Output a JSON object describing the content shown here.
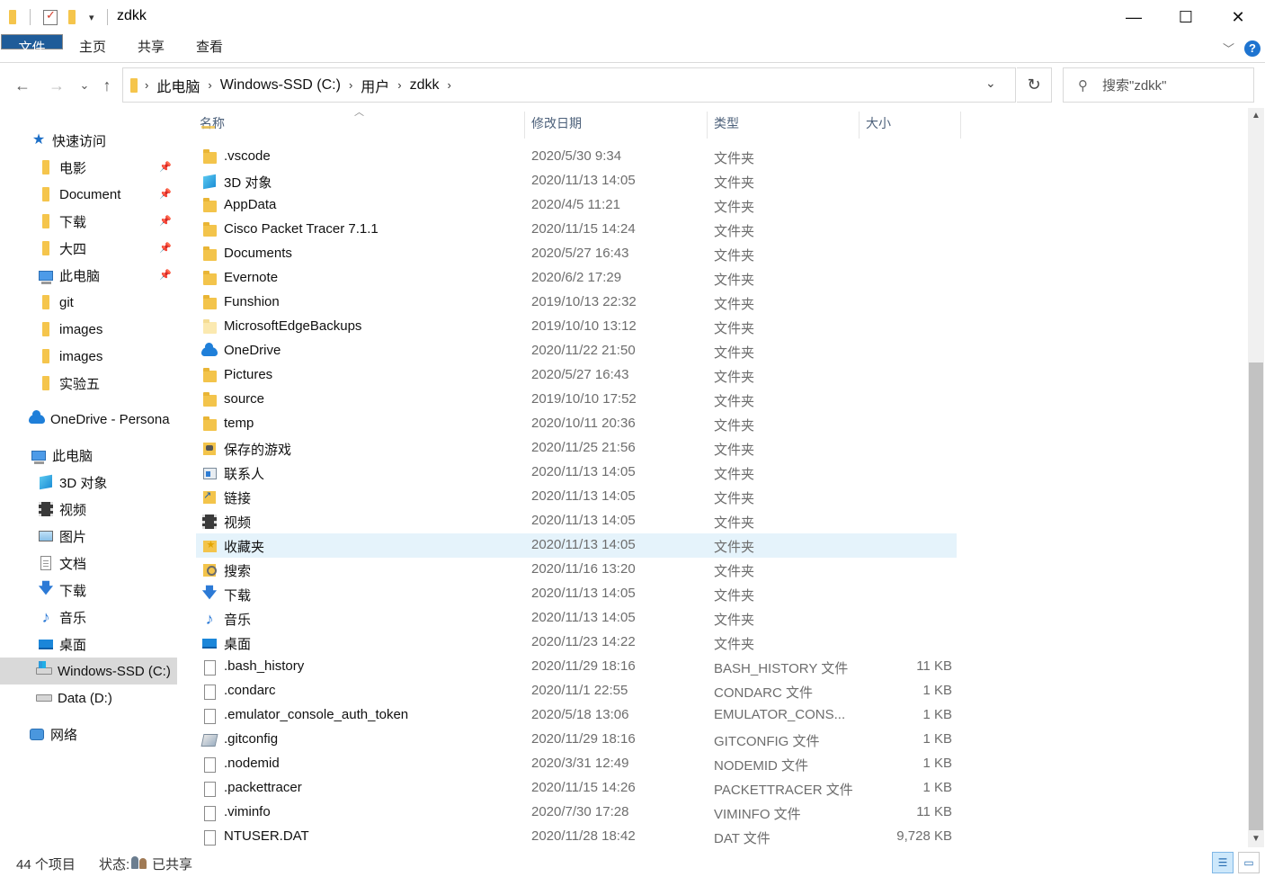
{
  "window": {
    "title": "zdkk",
    "minimize": "—",
    "maximize": "☐",
    "close": "✕"
  },
  "ribbon": {
    "tabs": [
      {
        "label": "文件"
      },
      {
        "label": "主页"
      },
      {
        "label": "共享"
      },
      {
        "label": "查看"
      }
    ],
    "help": "?"
  },
  "nav": {
    "back": "←",
    "forward": "→",
    "recent": "⌄",
    "up": "↑"
  },
  "address": {
    "crumbs": [
      "此电脑",
      "Windows-SSD (C:)",
      "用户",
      "zdkk"
    ]
  },
  "search": {
    "placeholder": "搜索\"zdkk\""
  },
  "sidebar": {
    "items": [
      {
        "label": "快速访问",
        "icon": "star-icon"
      },
      {
        "label": "电影",
        "icon": "folder-icon",
        "pinned": true
      },
      {
        "label": "Document",
        "icon": "folder-icon",
        "pinned": true
      },
      {
        "label": "下载",
        "icon": "folder-icon",
        "pinned": true
      },
      {
        "label": "大四",
        "icon": "folder-icon",
        "pinned": true
      },
      {
        "label": "此电脑",
        "icon": "computer-icon",
        "pinned": true
      },
      {
        "label": "git",
        "icon": "folder-icon"
      },
      {
        "label": "images",
        "icon": "folder-icon"
      },
      {
        "label": "images",
        "icon": "folder-icon"
      },
      {
        "label": "实验五",
        "icon": "folder-icon"
      },
      {
        "label": "OneDrive - Persona",
        "icon": "onedrive-icon"
      },
      {
        "label": "此电脑",
        "icon": "computer-icon"
      },
      {
        "label": "3D 对象",
        "icon": "3d-objects-icon"
      },
      {
        "label": "视频",
        "icon": "video-icon"
      },
      {
        "label": "图片",
        "icon": "pictures-icon"
      },
      {
        "label": "文档",
        "icon": "documents-icon"
      },
      {
        "label": "下载",
        "icon": "download-icon"
      },
      {
        "label": "音乐",
        "icon": "music-icon"
      },
      {
        "label": "桌面",
        "icon": "desktop-icon"
      },
      {
        "label": "Windows-SSD (C:)",
        "icon": "windows-drive-icon",
        "selected": true
      },
      {
        "label": "Data (D:)",
        "icon": "drive-icon"
      },
      {
        "label": "网络",
        "icon": "network-icon"
      }
    ]
  },
  "columns": {
    "name": "名称",
    "date": "修改日期",
    "type": "类型",
    "size": "大小"
  },
  "files": [
    {
      "name": ".vscode",
      "date": "2020/5/30 9:34",
      "type": "文件夹",
      "size": "",
      "icon": "folder"
    },
    {
      "name": "3D 对象",
      "date": "2020/11/13 14:05",
      "type": "文件夹",
      "size": "",
      "icon": "cube"
    },
    {
      "name": "AppData",
      "date": "2020/4/5 11:21",
      "type": "文件夹",
      "size": "",
      "icon": "folder"
    },
    {
      "name": "Cisco Packet Tracer 7.1.1",
      "date": "2020/11/15 14:24",
      "type": "文件夹",
      "size": "",
      "icon": "folder"
    },
    {
      "name": "Documents",
      "date": "2020/5/27 16:43",
      "type": "文件夹",
      "size": "",
      "icon": "folder"
    },
    {
      "name": "Evernote",
      "date": "2020/6/2 17:29",
      "type": "文件夹",
      "size": "",
      "icon": "folder"
    },
    {
      "name": "Funshion",
      "date": "2019/10/13 22:32",
      "type": "文件夹",
      "size": "",
      "icon": "folder"
    },
    {
      "name": "MicrosoftEdgeBackups",
      "date": "2019/10/10 13:12",
      "type": "文件夹",
      "size": "",
      "icon": "folder-pale"
    },
    {
      "name": "OneDrive",
      "date": "2020/11/22 21:50",
      "type": "文件夹",
      "size": "",
      "icon": "cloud"
    },
    {
      "name": "Pictures",
      "date": "2020/5/27 16:43",
      "type": "文件夹",
      "size": "",
      "icon": "folder"
    },
    {
      "name": "source",
      "date": "2019/10/10 17:52",
      "type": "文件夹",
      "size": "",
      "icon": "folder"
    },
    {
      "name": "temp",
      "date": "2020/10/11 20:36",
      "type": "文件夹",
      "size": "",
      "icon": "folder"
    },
    {
      "name": "保存的游戏",
      "date": "2020/11/25 21:56",
      "type": "文件夹",
      "size": "",
      "icon": "game"
    },
    {
      "name": "联系人",
      "date": "2020/11/13 14:05",
      "type": "文件夹",
      "size": "",
      "icon": "contacts"
    },
    {
      "name": "链接",
      "date": "2020/11/13 14:05",
      "type": "文件夹",
      "size": "",
      "icon": "link"
    },
    {
      "name": "视频",
      "date": "2020/11/13 14:05",
      "type": "文件夹",
      "size": "",
      "icon": "film"
    },
    {
      "name": "收藏夹",
      "date": "2020/11/13 14:05",
      "type": "文件夹",
      "size": "",
      "icon": "fav",
      "selected": true
    },
    {
      "name": "搜索",
      "date": "2020/11/16 13:20",
      "type": "文件夹",
      "size": "",
      "icon": "srch"
    },
    {
      "name": "下载",
      "date": "2020/11/13 14:05",
      "type": "文件夹",
      "size": "",
      "icon": "down"
    },
    {
      "name": "音乐",
      "date": "2020/11/13 14:05",
      "type": "文件夹",
      "size": "",
      "icon": "music"
    },
    {
      "name": "桌面",
      "date": "2020/11/23 14:22",
      "type": "文件夹",
      "size": "",
      "icon": "desk"
    },
    {
      "name": ".bash_history",
      "date": "2020/11/29 18:16",
      "type": "BASH_HISTORY 文件",
      "size": "11 KB",
      "icon": "file"
    },
    {
      "name": ".condarc",
      "date": "2020/11/1 22:55",
      "type": "CONDARC 文件",
      "size": "1 KB",
      "icon": "file"
    },
    {
      "name": ".emulator_console_auth_token",
      "date": "2020/5/18 13:06",
      "type": "EMULATOR_CONS...",
      "size": "1 KB",
      "icon": "file"
    },
    {
      "name": ".gitconfig",
      "date": "2020/11/29 18:16",
      "type": "GITCONFIG 文件",
      "size": "1 KB",
      "icon": "gitfile"
    },
    {
      "name": ".nodemid",
      "date": "2020/3/31 12:49",
      "type": "NODEMID 文件",
      "size": "1 KB",
      "icon": "file"
    },
    {
      "name": ".packettracer",
      "date": "2020/11/15 14:26",
      "type": "PACKETTRACER 文件",
      "size": "1 KB",
      "icon": "file"
    },
    {
      "name": ".viminfo",
      "date": "2020/7/30 17:28",
      "type": "VIMINFO 文件",
      "size": "11 KB",
      "icon": "file"
    },
    {
      "name": "NTUSER.DAT",
      "date": "2020/11/28 18:42",
      "type": "DAT 文件",
      "size": "9,728 KB",
      "icon": "file"
    }
  ],
  "status": {
    "count": "44 个项目",
    "state": "状态:",
    "shared": "已共享"
  }
}
